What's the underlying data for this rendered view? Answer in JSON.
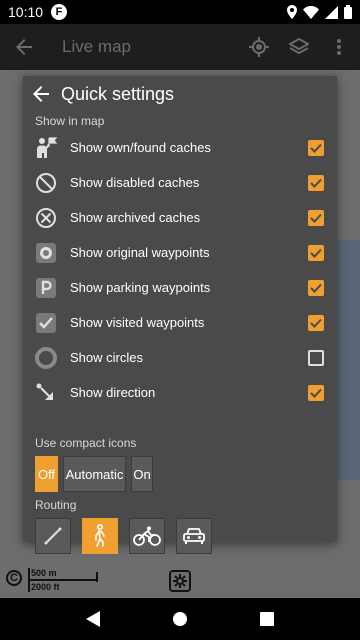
{
  "status_bar": {
    "time": "10:10",
    "app_badge": "F"
  },
  "app_bar": {
    "title": "Live map"
  },
  "dialog": {
    "title": "Quick settings",
    "show_in_map_label": "Show in map",
    "options": [
      {
        "label": "Show own/found caches",
        "checked": true,
        "icon": "own-found-caches-icon"
      },
      {
        "label": "Show disabled caches",
        "checked": true,
        "icon": "disabled-caches-icon"
      },
      {
        "label": "Show archived caches",
        "checked": true,
        "icon": "archived-caches-icon"
      },
      {
        "label": "Show original waypoints",
        "checked": true,
        "icon": "original-waypoints-icon"
      },
      {
        "label": "Show parking waypoints",
        "checked": true,
        "icon": "parking-waypoints-icon"
      },
      {
        "label": "Show visited waypoints",
        "checked": true,
        "icon": "visited-waypoints-icon"
      },
      {
        "label": "Show circles",
        "checked": false,
        "icon": "circles-icon"
      },
      {
        "label": "Show direction",
        "checked": true,
        "icon": "direction-icon"
      }
    ],
    "compact_icons": {
      "label": "Use compact icons",
      "options": [
        "Off",
        "Automatic",
        "On"
      ],
      "selected": "Off"
    },
    "routing": {
      "label": "Routing",
      "modes": [
        "straight-line",
        "walking",
        "cycling",
        "car"
      ],
      "selected": "walking"
    }
  },
  "map": {
    "copyright_symbol": "C",
    "scale_metric": "500 m",
    "scale_imperial": "2000 ft"
  },
  "colors": {
    "accent": "#f0a030",
    "dialog_bg": "#4a4a4a"
  }
}
